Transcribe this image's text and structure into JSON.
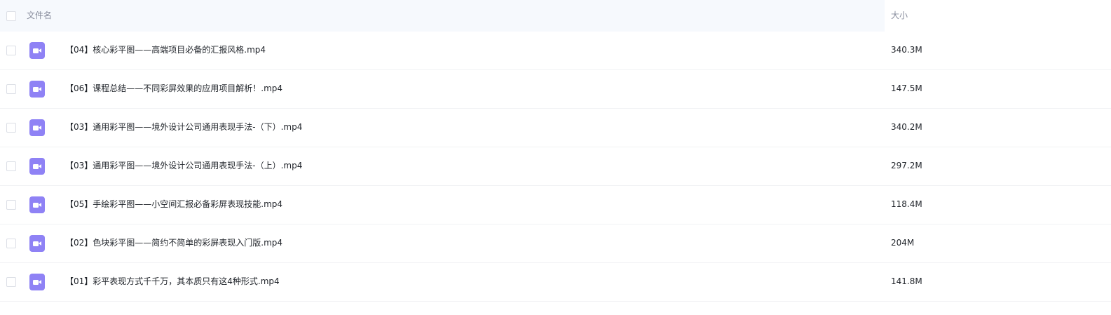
{
  "header": {
    "name_label": "文件名",
    "size_label": "大小"
  },
  "files": [
    {
      "name": "【04】核心彩平图——高端项目必备的汇报风格.mp4",
      "size": "340.3M",
      "icon": "video-file-icon"
    },
    {
      "name": "【06】课程总结——不同彩屏效果的应用项目解析！.mp4",
      "size": "147.5M",
      "icon": "video-file-icon"
    },
    {
      "name": "【03】通用彩平图——境外设计公司通用表现手法-（下）.mp4",
      "size": "340.2M",
      "icon": "video-file-icon"
    },
    {
      "name": "【03】通用彩平图——境外设计公司通用表现手法-（上）.mp4",
      "size": "297.2M",
      "icon": "video-file-icon"
    },
    {
      "name": "【05】手绘彩平图——小空间汇报必备彩屏表现技能.mp4",
      "size": "118.4M",
      "icon": "video-file-icon"
    },
    {
      "name": "【02】色块彩平图——简约不简单的彩屏表现入门版.mp4",
      "size": "204M",
      "icon": "video-file-icon"
    },
    {
      "name": "【01】彩平表现方式千千万，其本质只有这4种形式.mp4",
      "size": "141.8M",
      "icon": "video-file-icon"
    }
  ],
  "colors": {
    "header_bg": "#f6f9fd",
    "icon_bg": "#8f82f5",
    "header_text": "#878c9c",
    "row_text": "#1f2329"
  }
}
